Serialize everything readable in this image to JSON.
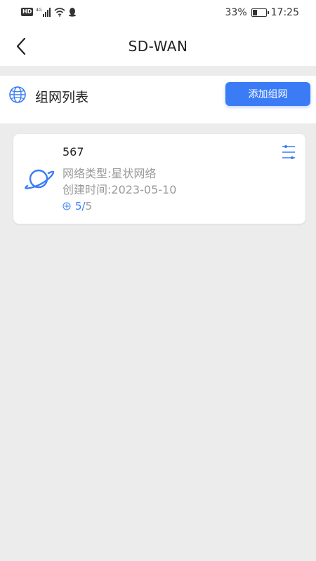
{
  "status_bar": {
    "badge": "HD",
    "network": "4G",
    "battery_text": "33%",
    "battery_level": 0.33,
    "time": "17:25"
  },
  "nav": {
    "title": "SD-WAN"
  },
  "section": {
    "title": "组网列表",
    "add_button": "添加组网"
  },
  "networks": [
    {
      "name": "567",
      "type_label": "网络类型:星状网络",
      "created_label": "创建时间:2023-05-10",
      "online": "5",
      "separator": "/",
      "total": "5"
    }
  ],
  "colors": {
    "accent": "#3b7cf6",
    "background": "#ececec",
    "secondary_text": "#999999"
  }
}
